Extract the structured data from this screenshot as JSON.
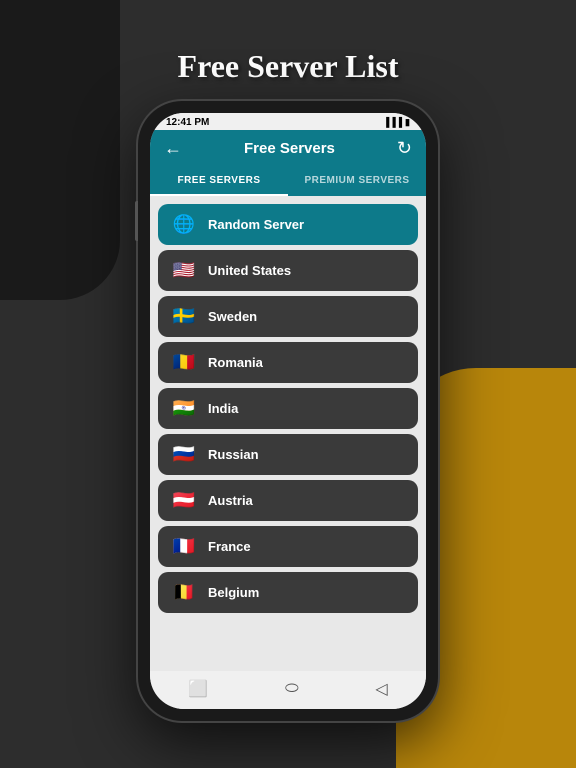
{
  "page": {
    "title": "Free Server List",
    "background_color": "#2d2d2d",
    "accent_color": "#b8860b"
  },
  "status_bar": {
    "time": "12:41 PM",
    "signal": "▐▐▐",
    "battery": "🔋"
  },
  "header": {
    "back_label": "←",
    "title": "Free Servers",
    "refresh_label": "↻"
  },
  "tabs": [
    {
      "label": "FREE SERVERS",
      "active": true
    },
    {
      "label": "PREMIUM SERVERS",
      "active": false
    }
  ],
  "servers": [
    {
      "name": "Random Server",
      "flag": "🌐",
      "type": "random"
    },
    {
      "name": "United States",
      "flag": "🇺🇸",
      "type": "normal"
    },
    {
      "name": "Sweden",
      "flag": "🇸🇪",
      "type": "normal"
    },
    {
      "name": "Romania",
      "flag": "🇷🇴",
      "type": "normal"
    },
    {
      "name": "India",
      "flag": "🇮🇳",
      "type": "normal"
    },
    {
      "name": "Russian",
      "flag": "🇷🇺",
      "type": "normal"
    },
    {
      "name": "Austria",
      "flag": "🇦🇹",
      "type": "normal"
    },
    {
      "name": "France",
      "flag": "🇫🇷",
      "type": "normal"
    },
    {
      "name": "Belgium",
      "flag": "🇧🇪",
      "type": "normal"
    }
  ],
  "nav_icons": [
    "⬜",
    "⬭",
    "◁"
  ]
}
